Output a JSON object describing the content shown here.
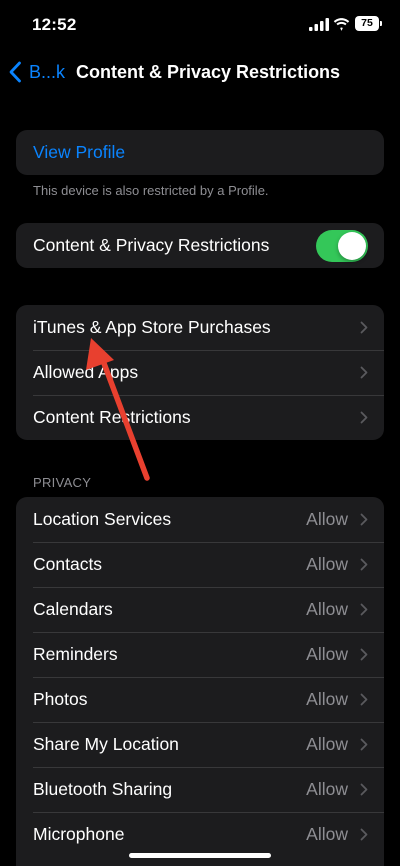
{
  "status_bar": {
    "time": "12:52",
    "battery_level": "75",
    "icons": [
      "signal-icon",
      "wifi-icon",
      "battery-icon"
    ]
  },
  "nav": {
    "back_label": "B...k",
    "title": "Content & Privacy Restrictions"
  },
  "profile": {
    "view_profile_label": "View Profile",
    "footnote": "This device is also restricted by a Profile."
  },
  "restrictions_toggle": {
    "label": "Content & Privacy Restrictions",
    "on": true
  },
  "store_group": {
    "items": [
      {
        "label": "iTunes & App Store Purchases"
      },
      {
        "label": "Allowed Apps"
      },
      {
        "label": "Content Restrictions"
      }
    ]
  },
  "privacy": {
    "header": "PRIVACY",
    "items": [
      {
        "label": "Location Services",
        "value": "Allow"
      },
      {
        "label": "Contacts",
        "value": "Allow"
      },
      {
        "label": "Calendars",
        "value": "Allow"
      },
      {
        "label": "Reminders",
        "value": "Allow"
      },
      {
        "label": "Photos",
        "value": "Allow"
      },
      {
        "label": "Share My Location",
        "value": "Allow"
      },
      {
        "label": "Bluetooth Sharing",
        "value": "Allow"
      },
      {
        "label": "Microphone",
        "value": "Allow"
      }
    ]
  },
  "colors": {
    "background": "#000000",
    "group_background": "#1c1c1e",
    "accent": "#0a84ff",
    "toggle_on": "#34c759",
    "secondary_text": "#8e8e93",
    "annotation_arrow": "#e8402f"
  }
}
